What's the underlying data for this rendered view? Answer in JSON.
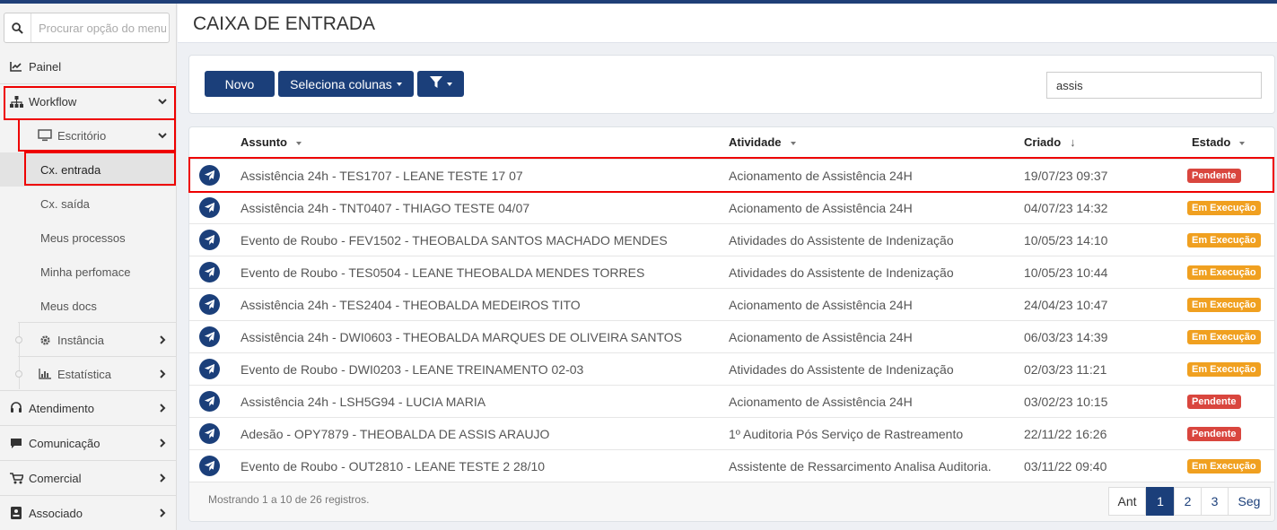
{
  "sidebar": {
    "search_placeholder": "Procurar opção do menu",
    "items": [
      {
        "label": "Painel",
        "icon": "line-chart-icon"
      },
      {
        "label": "Workflow",
        "icon": "sitemap-icon"
      },
      {
        "label": "Escritório",
        "icon": "monitor-icon"
      },
      {
        "label": "Cx. entrada"
      },
      {
        "label": "Cx. saída"
      },
      {
        "label": "Meus processos"
      },
      {
        "label": "Minha perfomace"
      },
      {
        "label": "Meus docs"
      },
      {
        "label": "Instância",
        "icon": "gear-icon"
      },
      {
        "label": "Estatística",
        "icon": "bar-chart-icon"
      },
      {
        "label": "Atendimento",
        "icon": "headset-icon"
      },
      {
        "label": "Comunicação",
        "icon": "comment-icon"
      },
      {
        "label": "Comercial",
        "icon": "cart-icon"
      },
      {
        "label": "Associado",
        "icon": "id-card-icon"
      }
    ]
  },
  "header": {
    "title": "CAIXA DE ENTRADA"
  },
  "toolbar": {
    "new_label": "Novo",
    "columns_label": "Seleciona colunas",
    "search_value": "assis"
  },
  "table": {
    "headers": {
      "subject": "Assunto",
      "activity": "Atividade",
      "created": "Criado",
      "state": "Estado"
    },
    "rows": [
      {
        "subject": "Assistência 24h - TES1707 - LEANE TESTE 17 07",
        "activity": "Acionamento de Assistência 24H",
        "created": "19/07/23 09:37",
        "state": "Pendente"
      },
      {
        "subject": "Assistência 24h - TNT0407 - THIAGO TESTE 04/07",
        "activity": "Acionamento de Assistência 24H",
        "created": "04/07/23 14:32",
        "state": "Em Execução"
      },
      {
        "subject": "Evento de Roubo - FEV1502 - THEOBALDA SANTOS MACHADO MENDES",
        "activity": "Atividades do Assistente de Indenização",
        "created": "10/05/23 14:10",
        "state": "Em Execução"
      },
      {
        "subject": "Evento de Roubo - TES0504 - LEANE THEOBALDA MENDES TORRES",
        "activity": "Atividades do Assistente de Indenização",
        "created": "10/05/23 10:44",
        "state": "Em Execução"
      },
      {
        "subject": "Assistência 24h - TES2404 - THEOBALDA MEDEIROS TITO",
        "activity": "Acionamento de Assistência 24H",
        "created": "24/04/23 10:47",
        "state": "Em Execução"
      },
      {
        "subject": "Assistência 24h - DWI0603 - THEOBALDA MARQUES DE OLIVEIRA SANTOS",
        "activity": "Acionamento de Assistência 24H",
        "created": "06/03/23 14:39",
        "state": "Em Execução"
      },
      {
        "subject": "Evento de Roubo - DWI0203 - LEANE TREINAMENTO 02-03",
        "activity": "Atividades do Assistente de Indenização",
        "created": "02/03/23 11:21",
        "state": "Em Execução"
      },
      {
        "subject": "Assistência 24h - LSH5G94 - LUCIA MARIA",
        "activity": "Acionamento de Assistência 24H",
        "created": "03/02/23 10:15",
        "state": "Pendente"
      },
      {
        "subject": "Adesão - OPY7879 - THEOBALDA DE ASSIS ARAUJO",
        "activity": "1º Auditoria Pós Serviço de Rastreamento",
        "created": "22/11/22 16:26",
        "state": "Pendente"
      },
      {
        "subject": "Evento de Roubo - OUT2810 - LEANE TESTE 2 28/10",
        "activity": "Assistente de Ressarcimento Analisa Auditoria.",
        "created": "03/11/22 09:40",
        "state": "Em Execução"
      }
    ],
    "footer_info": "Mostrando 1 a 10 de 26 registros."
  },
  "pagination": {
    "prev": "Ant",
    "pages": [
      "1",
      "2",
      "3"
    ],
    "next": "Seg"
  },
  "colors": {
    "primary": "#1b3f7a",
    "pending": "#d9463e",
    "executing": "#f0a020",
    "highlight": "#e00000"
  }
}
